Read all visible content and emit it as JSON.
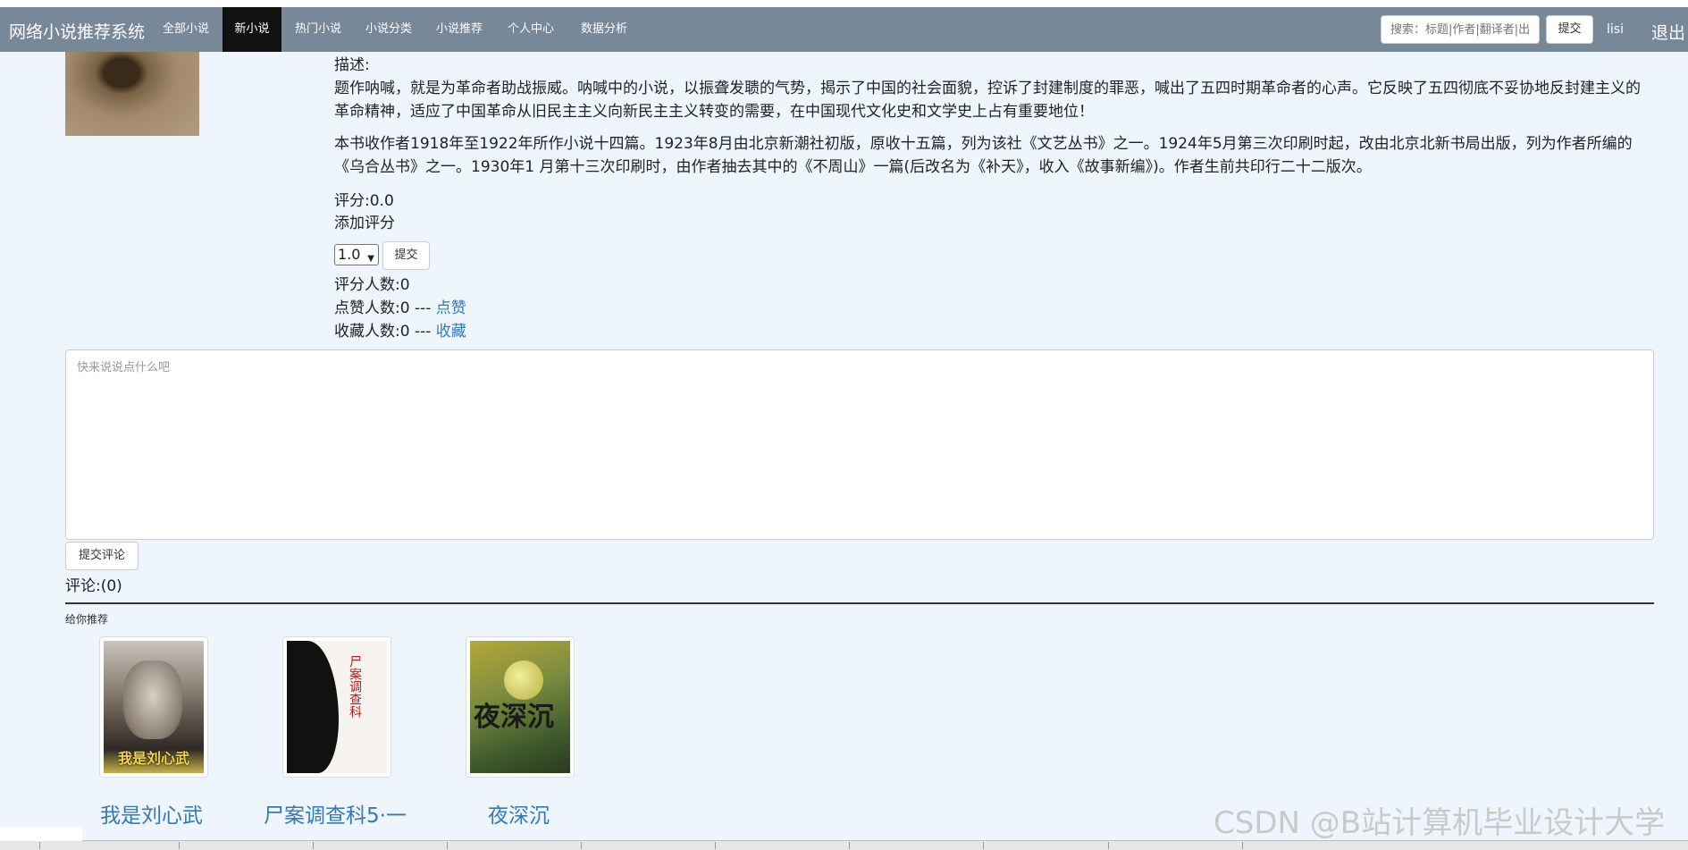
{
  "nav": {
    "brand": "网络小说推荐系统",
    "items": [
      {
        "label": "全部小说"
      },
      {
        "label": "新小说"
      },
      {
        "label": "热门小说"
      },
      {
        "label": "小说分类"
      },
      {
        "label": "小说推荐"
      },
      {
        "label": "个人中心"
      },
      {
        "label": "数据分析"
      }
    ],
    "active_index": 1,
    "search_placeholder": "搜索：标题|作者|翻译者|出",
    "search_button": "提交",
    "user": "lisi",
    "logout": "退出"
  },
  "book": {
    "desc_label": "描述:",
    "desc_p1": "题作呐喊，就是为革命者助战振威。呐喊中的小说，以振聋发聩的气势，揭示了中国的社会面貌，控诉了封建制度的罪恶，喊出了五四时期革命者的心声。它反映了五四彻底不妥协地反封建主义的革命精神，适应了中国革命从旧民主主义向新民主主义转变的需要，在中国现代文化史和文学史上占有重要地位！",
    "desc_p2": "本书收作者1918年至1922年所作小说十四篇。1923年8月由北京新潮社初版，原收十五篇，列为该社《文艺丛书》之一。1924年5月第三次印刷时起，改由北京北新书局出版，列为作者所编的《乌合丛书》之一。1930年1 月第十三次印刷时，由作者抽去其中的《不周山》一篇(后改名为《补天》，收入《故事新编》)。作者生前共印行二十二版次。",
    "rating": "评分:0.0",
    "add_rating": "添加评分",
    "rating_value": "1.0",
    "rating_submit": "提交",
    "raters": "评分人数:0",
    "likes": "点赞人数:0 --- ",
    "like_link": "点赞",
    "favorites": "收藏人数:0 --- ",
    "favorite_link": "收藏"
  },
  "comment": {
    "placeholder": "快来说说点什么吧",
    "submit": "提交评论",
    "count": "评论:(0)"
  },
  "recommend": {
    "title": "给你推荐",
    "books": [
      {
        "name": "我是刘心武",
        "cover_text": "我是刘心武"
      },
      {
        "name": "尸案调查科5·一",
        "cover_text": "尸案调查科"
      },
      {
        "name": "夜深沉",
        "cover_text": "夜深沉"
      }
    ]
  },
  "watermark": "CSDN @B站计算机毕业设计大学"
}
